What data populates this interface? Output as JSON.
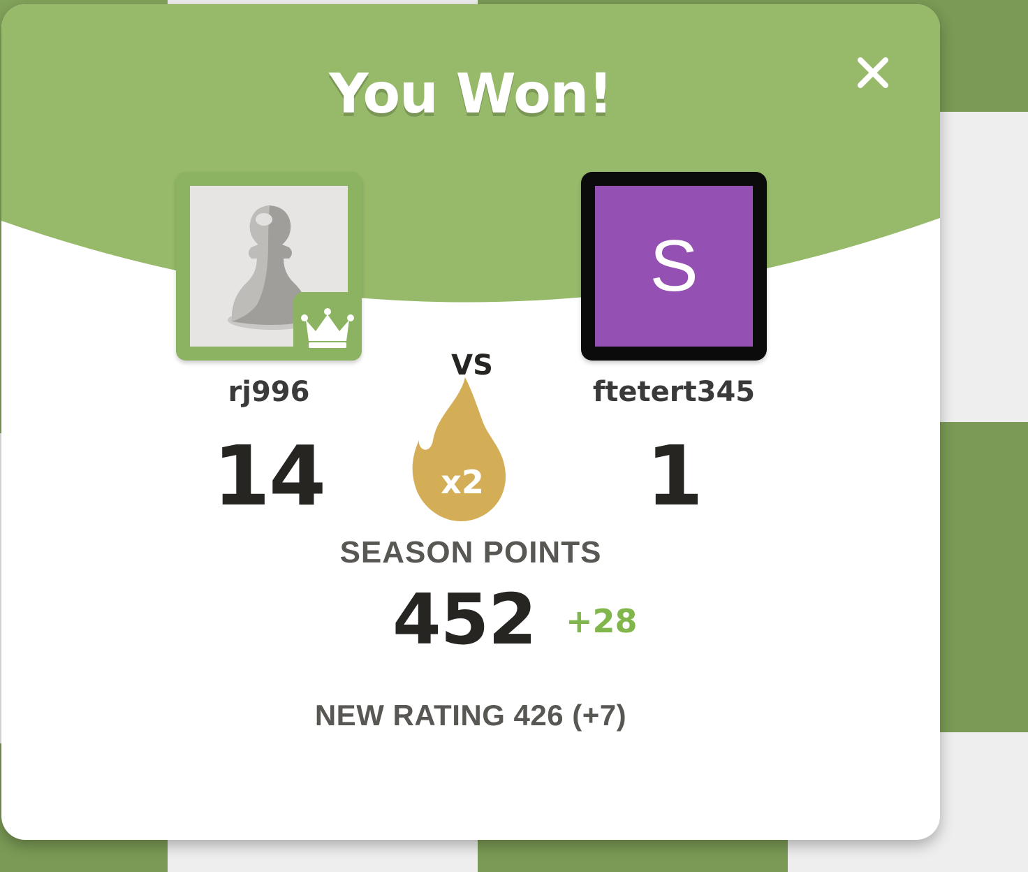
{
  "modal": {
    "title": "You Won!",
    "close_icon": "close-icon",
    "header_color": "#96b96a",
    "accent_green": "#81b64c"
  },
  "players": {
    "left": {
      "username": "rj996",
      "score": "14",
      "avatar_icon": "pawn-icon",
      "badge_icon": "crown-icon",
      "border_color": "#8cb361"
    },
    "right": {
      "username": "ftetert345",
      "score": "1",
      "avatar_letter": "S",
      "avatar_color": "#9451b3",
      "border_color": "#0b0b0b"
    }
  },
  "versus": {
    "label": "VS",
    "streak_icon": "flame-icon",
    "streak_multiplier": "x2",
    "streak_color": "#d4ad57"
  },
  "season": {
    "label": "SEASON POINTS",
    "points": "452",
    "delta": "+28"
  },
  "rating": {
    "text": "NEW RATING 426 (+7)"
  }
}
